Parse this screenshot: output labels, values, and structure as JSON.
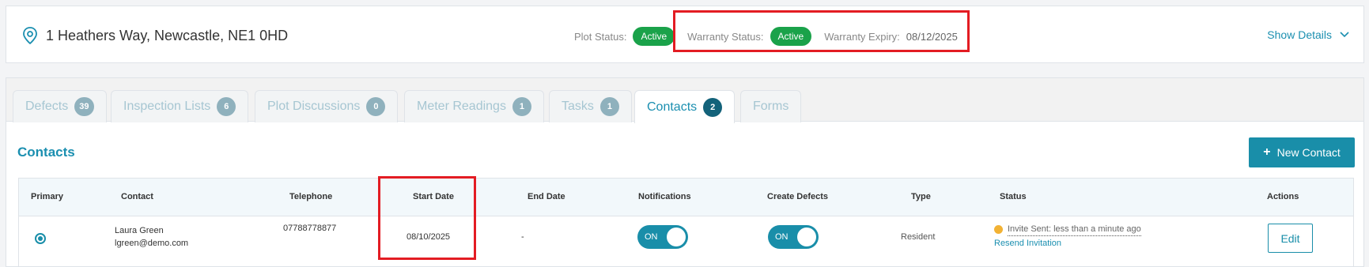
{
  "header": {
    "address": "1 Heathers Way, Newcastle, NE1 0HD",
    "plot_status_label": "Plot Status:",
    "plot_status_value": "Active",
    "warranty_status_label": "Warranty Status:",
    "warranty_status_value": "Active",
    "warranty_expiry_label": "Warranty Expiry:",
    "warranty_expiry_value": "08/12/2025",
    "show_details_label": "Show Details",
    "active_badge_color": "#1aa24a"
  },
  "tabs": [
    {
      "label": "Defects",
      "count": "39",
      "active": false
    },
    {
      "label": "Inspection Lists",
      "count": "6",
      "active": false
    },
    {
      "label": "Plot Discussions",
      "count": "0",
      "active": false
    },
    {
      "label": "Meter Readings",
      "count": "1",
      "active": false
    },
    {
      "label": "Tasks",
      "count": "1",
      "active": false
    },
    {
      "label": "Contacts",
      "count": "2",
      "active": true
    },
    {
      "label": "Forms",
      "count": "",
      "active": false
    }
  ],
  "contacts": {
    "title": "Contacts",
    "new_contact_label": "New Contact",
    "columns": [
      "Primary",
      "Contact",
      "Telephone",
      "Start Date",
      "End Date",
      "Notifications",
      "Create Defects",
      "Type",
      "Status",
      "Actions"
    ],
    "rows": [
      {
        "primary": true,
        "name": "Laura Green",
        "email": "lgreen@demo.com",
        "telephone": "07788778877",
        "start_date": "08/10/2025",
        "end_date": "-",
        "notifications": "ON",
        "create_defects": "ON",
        "type": "Resident",
        "status_text": "Invite Sent: less than a minute ago",
        "resend_label": "Resend Invitation",
        "action_label": "Edit"
      }
    ]
  },
  "colors": {
    "accent": "#198ea9",
    "highlight": "#e31c23",
    "pending": "#f2b234"
  }
}
